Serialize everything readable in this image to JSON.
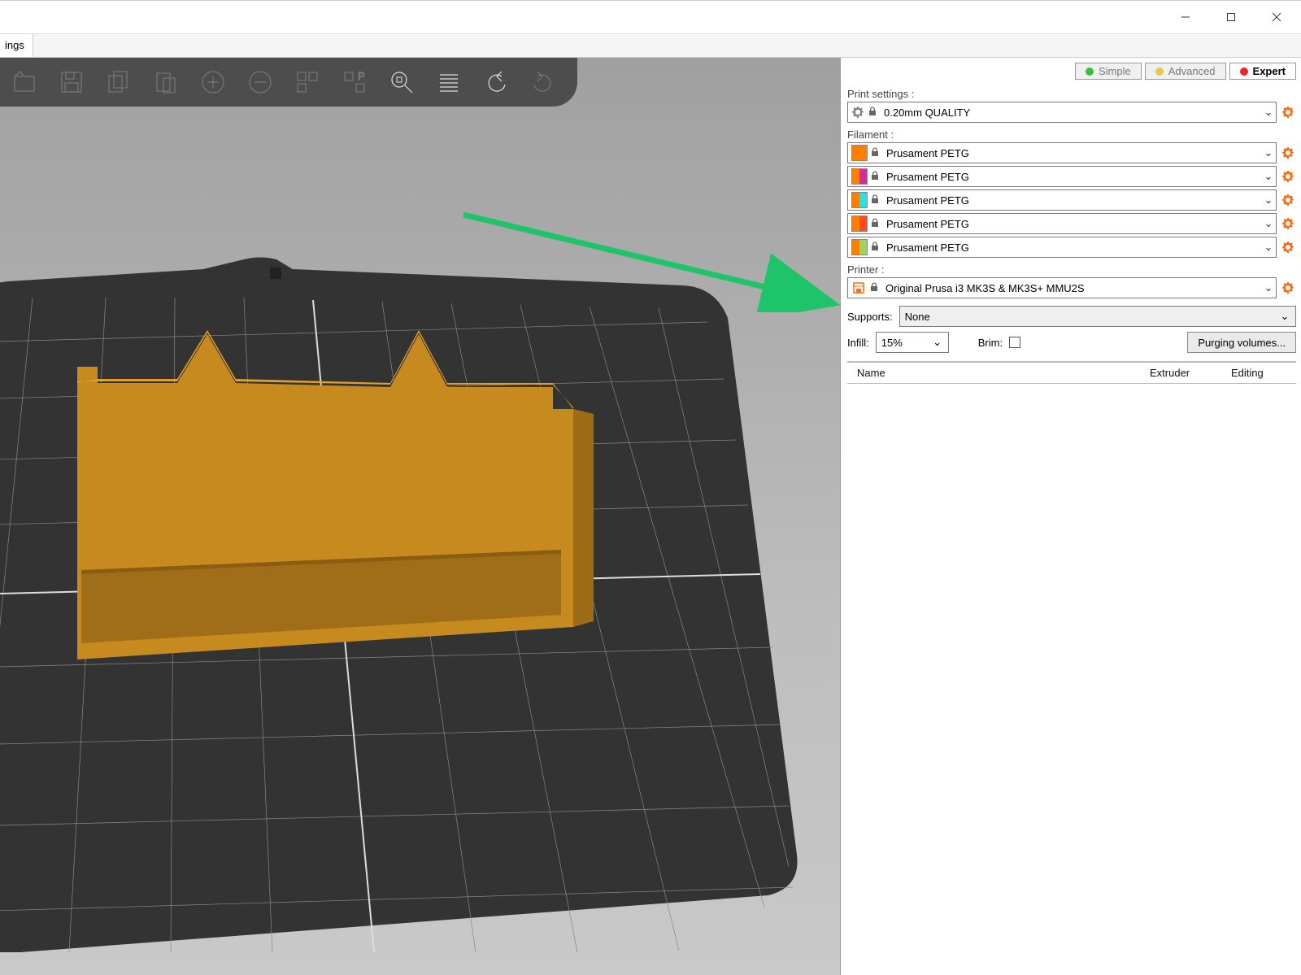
{
  "menubar": {
    "item0": "ings"
  },
  "modes": {
    "simple": "Simple",
    "advanced": "Advanced",
    "expert": "Expert"
  },
  "labels": {
    "print_settings": "Print settings :",
    "filament": "Filament :",
    "printer": "Printer :",
    "supports": "Supports:",
    "infill": "Infill:",
    "brim": "Brim:",
    "purging": "Purging volumes...",
    "col_name": "Name",
    "col_extruder": "Extruder",
    "col_editing": "Editing"
  },
  "print_settings": {
    "value": "0.20mm QUALITY"
  },
  "filaments": [
    {
      "name": "Prusament PETG",
      "c1": "#FF7F00",
      "c2": "#FF7F00"
    },
    {
      "name": "Prusament PETG",
      "c1": "#FF7F00",
      "c2": "#D82AA0"
    },
    {
      "name": "Prusament PETG",
      "c1": "#FF7F00",
      "c2": "#27E0E8"
    },
    {
      "name": "Prusament PETG",
      "c1": "#FF7F00",
      "c2": "#FF4A1C"
    },
    {
      "name": "Prusament PETG",
      "c1": "#FF7F00",
      "c2": "#9BD65A"
    }
  ],
  "printer": {
    "value": "Original Prusa i3 MK3S & MK3S+ MMU2S"
  },
  "supports": {
    "value": "None"
  },
  "infill": {
    "value": "15%"
  }
}
